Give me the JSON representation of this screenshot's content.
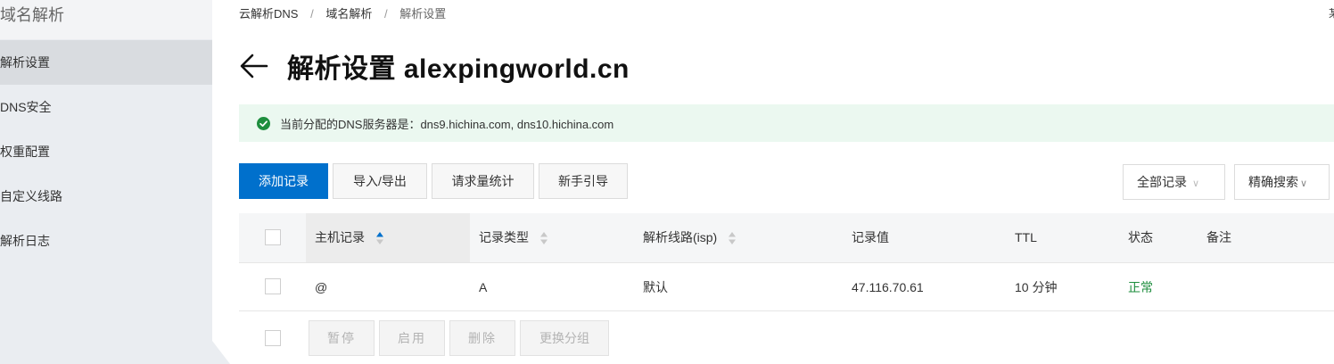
{
  "sidebar": {
    "title": "域名解析",
    "items": [
      {
        "label": "解析设置",
        "active": true
      },
      {
        "label": "DNS安全",
        "active": false
      },
      {
        "label": "权重配置",
        "active": false
      },
      {
        "label": "自定义线路",
        "active": false
      },
      {
        "label": "解析日志",
        "active": false
      }
    ]
  },
  "breadcrumb": {
    "items": [
      "云解析DNS",
      "域名解析",
      "解析设置"
    ],
    "separator": "/"
  },
  "header": {
    "right_text": "某"
  },
  "page": {
    "title": "解析设置 alexpingworld.cn"
  },
  "notice": {
    "text": "当前分配的DNS服务器是：dns9.hichina.com, dns10.hichina.com"
  },
  "toolbar": {
    "add_record": "添加记录",
    "import_export": "导入/导出",
    "request_stats": "请求量统计",
    "beginner_guide": "新手引导",
    "filter_select": "全部记录",
    "search_mode": "精确搜索"
  },
  "table": {
    "columns": [
      "主机记录",
      "记录类型",
      "解析线路(isp)",
      "记录值",
      "TTL",
      "状态",
      "备注"
    ],
    "rows": [
      {
        "host": "@",
        "type": "A",
        "line": "默认",
        "value": "47.116.70.61",
        "ttl": "10 分钟",
        "status": "正常",
        "remark": ""
      }
    ]
  },
  "bulk_actions": {
    "pause": "暂停",
    "enable": "启用",
    "delete": "删除",
    "change_group": "更换分组"
  },
  "colors": {
    "primary": "#0070cc",
    "status_ok": "#1e8e3e",
    "notice_bg": "#ebf8f0",
    "sort_active": "#0070cc"
  }
}
